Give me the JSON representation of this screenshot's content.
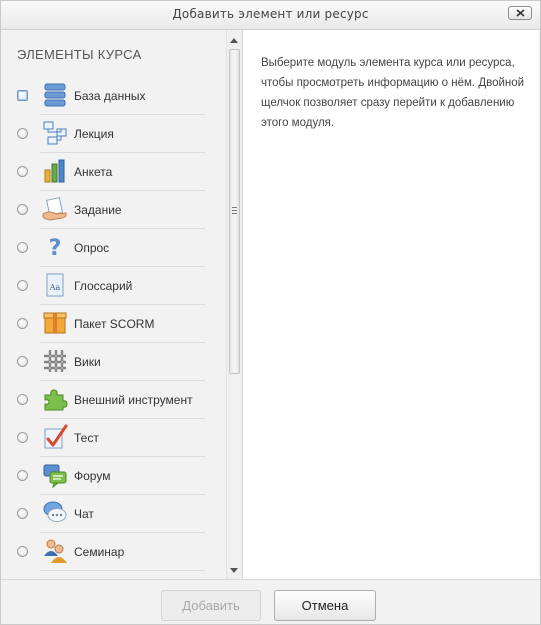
{
  "dialog": {
    "title": "Добавить элемент или ресурс",
    "section_title": "ЭЛЕМЕНТЫ КУРСА",
    "info_text": "Выберите модуль элемента курса или ресурса, чтобы просмотреть информацию о нём. Двойной щелчок позволяет сразу перейти к добавлению этого модуля.",
    "modules": [
      {
        "label": "База данных",
        "icon": "database-icon"
      },
      {
        "label": "Лекция",
        "icon": "lesson-icon"
      },
      {
        "label": "Анкета",
        "icon": "survey-icon"
      },
      {
        "label": "Задание",
        "icon": "assignment-icon"
      },
      {
        "label": "Опрос",
        "icon": "choice-icon"
      },
      {
        "label": "Глоссарий",
        "icon": "glossary-icon"
      },
      {
        "label": "Пакет SCORM",
        "icon": "scorm-package-icon"
      },
      {
        "label": "Вики",
        "icon": "wiki-icon"
      },
      {
        "label": "Внешний инструмент",
        "icon": "external-tool-icon"
      },
      {
        "label": "Тест",
        "icon": "quiz-icon"
      },
      {
        "label": "Форум",
        "icon": "forum-icon"
      },
      {
        "label": "Чат",
        "icon": "chat-icon"
      },
      {
        "label": "Семинар",
        "icon": "workshop-icon"
      }
    ],
    "buttons": {
      "add": "Добавить",
      "cancel": "Отмена"
    }
  }
}
